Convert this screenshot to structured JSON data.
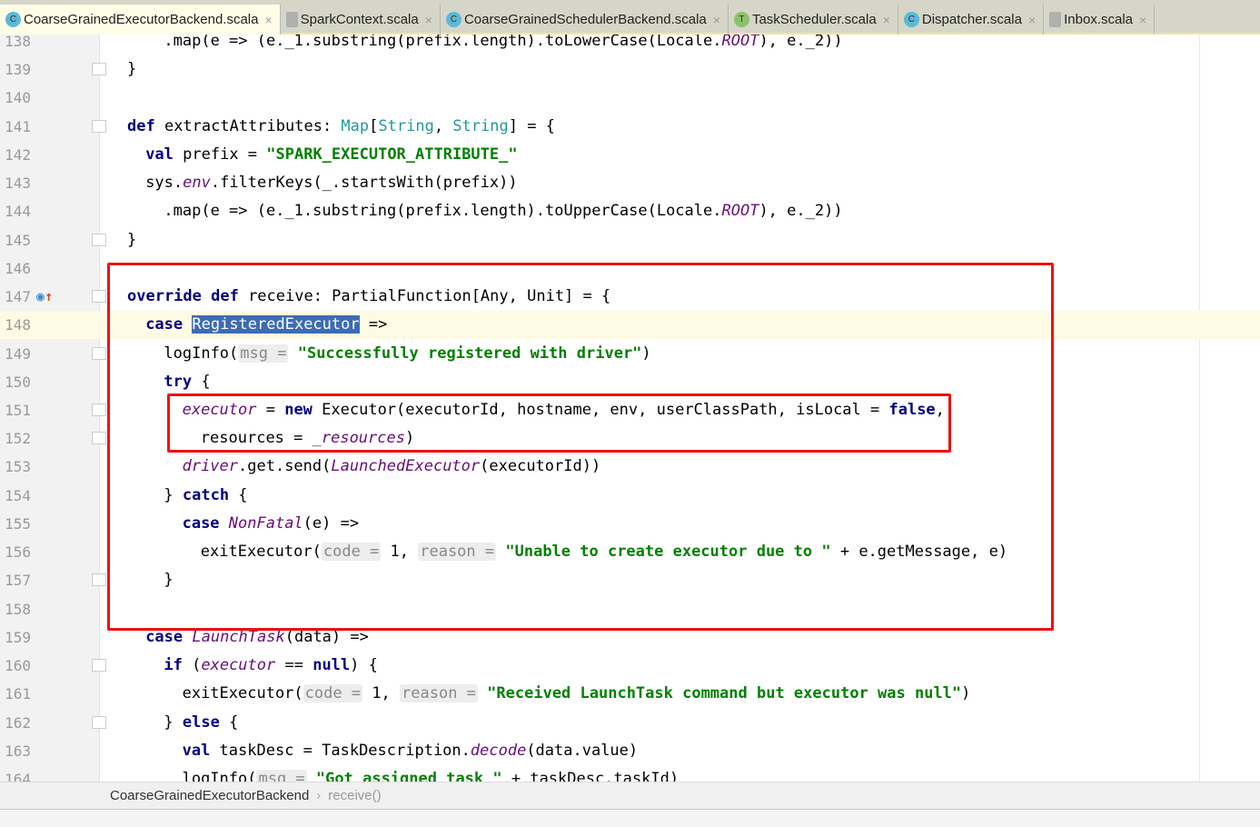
{
  "tabs": [
    {
      "label": "CoarseGrainedExecutorBackend.scala",
      "icon": "scala-class-icon",
      "active": true,
      "color": "#5DB8D6"
    },
    {
      "label": "SparkContext.scala",
      "icon": "scala-file-icon",
      "active": false,
      "color": "#B0B0B0"
    },
    {
      "label": "CoarseGrainedSchedulerBackend.scala",
      "icon": "scala-class-icon",
      "active": false,
      "color": "#5DB8D6"
    },
    {
      "label": "TaskScheduler.scala",
      "icon": "scala-trait-icon",
      "active": false,
      "color": "#8CC26C"
    },
    {
      "label": "Dispatcher.scala",
      "icon": "scala-class-icon",
      "active": false,
      "color": "#5DB8D6"
    },
    {
      "label": "Inbox.scala",
      "icon": "scala-file-icon",
      "active": false,
      "color": "#B0B0B0"
    }
  ],
  "icon_letters": {
    "scala-class-icon": "C",
    "scala-trait-icon": "T",
    "scala-file-icon": ""
  },
  "close_glyph": "×",
  "lines": [
    {
      "n": "138",
      "ind": 4,
      "t": [
        [
          ".map(e => (e._1.substring(prefix.length).toLowerCase(Locale.",
          ""
        ],
        [
          "ROOT",
          "it"
        ],
        [
          "), e._2))",
          ""
        ]
      ]
    },
    {
      "n": "139",
      "ind": 0,
      "fold": true,
      "t": [
        [
          "}",
          ""
        ]
      ]
    },
    {
      "n": "140",
      "ind": 0,
      "t": []
    },
    {
      "n": "141",
      "ind": 0,
      "fold": true,
      "t": [
        [
          "def ",
          "kw"
        ],
        [
          "extractAttributes: ",
          ""
        ],
        [
          "Map",
          "ty"
        ],
        [
          "[",
          ""
        ],
        [
          "String",
          "ty"
        ],
        [
          ", ",
          ""
        ],
        [
          "String",
          "ty"
        ],
        [
          "] = {",
          ""
        ]
      ]
    },
    {
      "n": "142",
      "ind": 2,
      "t": [
        [
          "val ",
          "kw"
        ],
        [
          "prefix = ",
          ""
        ],
        [
          "\"SPARK_EXECUTOR_ATTRIBUTE_\"",
          "str"
        ]
      ]
    },
    {
      "n": "143",
      "ind": 2,
      "t": [
        [
          "sys.",
          ""
        ],
        [
          "env",
          "it"
        ],
        [
          ".filterKeys(_.startsWith(prefix))",
          ""
        ]
      ]
    },
    {
      "n": "144",
      "ind": 4,
      "t": [
        [
          ".map(e => (e._1.substring(prefix.length).toUpperCase(Locale.",
          ""
        ],
        [
          "ROOT",
          "it"
        ],
        [
          "), e._2))",
          ""
        ]
      ]
    },
    {
      "n": "145",
      "ind": 0,
      "fold": true,
      "t": [
        [
          "}",
          ""
        ]
      ]
    },
    {
      "n": "146",
      "ind": 0,
      "t": []
    },
    {
      "n": "147",
      "ind": 0,
      "fold": true,
      "override": true,
      "t": [
        [
          "override def ",
          "kw"
        ],
        [
          "receive: PartialFunction[Any, Unit] = {",
          ""
        ]
      ]
    },
    {
      "n": "148",
      "ind": 2,
      "cur": true,
      "t": [
        [
          "case ",
          "kw"
        ],
        [
          "RegisteredExecutor",
          "sel"
        ],
        [
          " =>",
          ""
        ]
      ]
    },
    {
      "n": "149",
      "ind": 4,
      "fold": true,
      "t": [
        [
          "logInfo(",
          ""
        ],
        [
          "msg =",
          "hint"
        ],
        [
          " ",
          ""
        ],
        [
          "\"Successfully registered with driver\"",
          "str"
        ],
        [
          ")",
          ""
        ]
      ]
    },
    {
      "n": "150",
      "ind": 4,
      "t": [
        [
          "try ",
          "kw"
        ],
        [
          "{",
          ""
        ]
      ]
    },
    {
      "n": "151",
      "ind": 6,
      "fold": true,
      "t": [
        [
          "executor",
          "it"
        ],
        [
          " = ",
          ""
        ],
        [
          "new ",
          "kw"
        ],
        [
          "Executor(executorId, hostname, env, userClassPath, isLocal = ",
          ""
        ],
        [
          "false",
          "kw"
        ],
        [
          ",",
          ""
        ]
      ]
    },
    {
      "n": "152",
      "ind": 8,
      "fold": true,
      "t": [
        [
          "resources = ",
          ""
        ],
        [
          "_resources",
          "it"
        ],
        [
          ")",
          ""
        ]
      ]
    },
    {
      "n": "153",
      "ind": 6,
      "t": [
        [
          "driver",
          "it"
        ],
        [
          ".get.send(",
          ""
        ],
        [
          "LaunchedExecutor",
          "it"
        ],
        [
          "(executorId))",
          ""
        ]
      ]
    },
    {
      "n": "154",
      "ind": 4,
      "t": [
        [
          "} ",
          ""
        ],
        [
          "catch ",
          "kw"
        ],
        [
          "{",
          ""
        ]
      ]
    },
    {
      "n": "155",
      "ind": 6,
      "t": [
        [
          "case ",
          "kw"
        ],
        [
          "NonFatal",
          "it"
        ],
        [
          "(e) =>",
          ""
        ]
      ]
    },
    {
      "n": "156",
      "ind": 8,
      "t": [
        [
          "exitExecutor(",
          ""
        ],
        [
          "code =",
          "hint"
        ],
        [
          " 1, ",
          ""
        ],
        [
          "reason =",
          "hint"
        ],
        [
          " ",
          ""
        ],
        [
          "\"Unable to create executor due to \"",
          "str"
        ],
        [
          " + e.getMessage, e)",
          ""
        ]
      ]
    },
    {
      "n": "157",
      "ind": 4,
      "fold": true,
      "t": [
        [
          "}",
          ""
        ]
      ]
    },
    {
      "n": "158",
      "ind": 0,
      "t": []
    },
    {
      "n": "159",
      "ind": 2,
      "t": [
        [
          "case ",
          "kw"
        ],
        [
          "LaunchTask",
          "it"
        ],
        [
          "(data) =>",
          ""
        ]
      ]
    },
    {
      "n": "160",
      "ind": 4,
      "fold": true,
      "t": [
        [
          "if ",
          "kw"
        ],
        [
          "(",
          ""
        ],
        [
          "executor",
          "it"
        ],
        [
          " == ",
          ""
        ],
        [
          "null",
          "kw"
        ],
        [
          ") {",
          ""
        ]
      ]
    },
    {
      "n": "161",
      "ind": 6,
      "t": [
        [
          "exitExecutor(",
          ""
        ],
        [
          "code =",
          "hint"
        ],
        [
          " 1, ",
          ""
        ],
        [
          "reason =",
          "hint"
        ],
        [
          " ",
          ""
        ],
        [
          "\"Received LaunchTask command but executor was null\"",
          "str"
        ],
        [
          ")",
          ""
        ]
      ]
    },
    {
      "n": "162",
      "ind": 4,
      "fold": true,
      "t": [
        [
          "} ",
          ""
        ],
        [
          "else ",
          "kw"
        ],
        [
          "{",
          ""
        ]
      ]
    },
    {
      "n": "163",
      "ind": 6,
      "t": [
        [
          "val ",
          "kw"
        ],
        [
          "taskDesc = TaskDescription.",
          ""
        ],
        [
          "decode",
          "it"
        ],
        [
          "(data.value)",
          ""
        ]
      ]
    },
    {
      "n": "164",
      "ind": 6,
      "t": [
        [
          "logInfo(",
          ""
        ],
        [
          "msg =",
          "hint"
        ],
        [
          " ",
          ""
        ],
        [
          "\"Got assigned task \"",
          "str"
        ],
        [
          " + taskDesc.taskId)",
          ""
        ]
      ]
    }
  ],
  "breadcrumb": {
    "class": "CoarseGrainedExecutorBackend",
    "method": "receive()",
    "sep": "›"
  },
  "colors": {
    "highlight_box": "#F01010",
    "selection": "#3D6BB4",
    "current_line": "#FFFAE3"
  }
}
